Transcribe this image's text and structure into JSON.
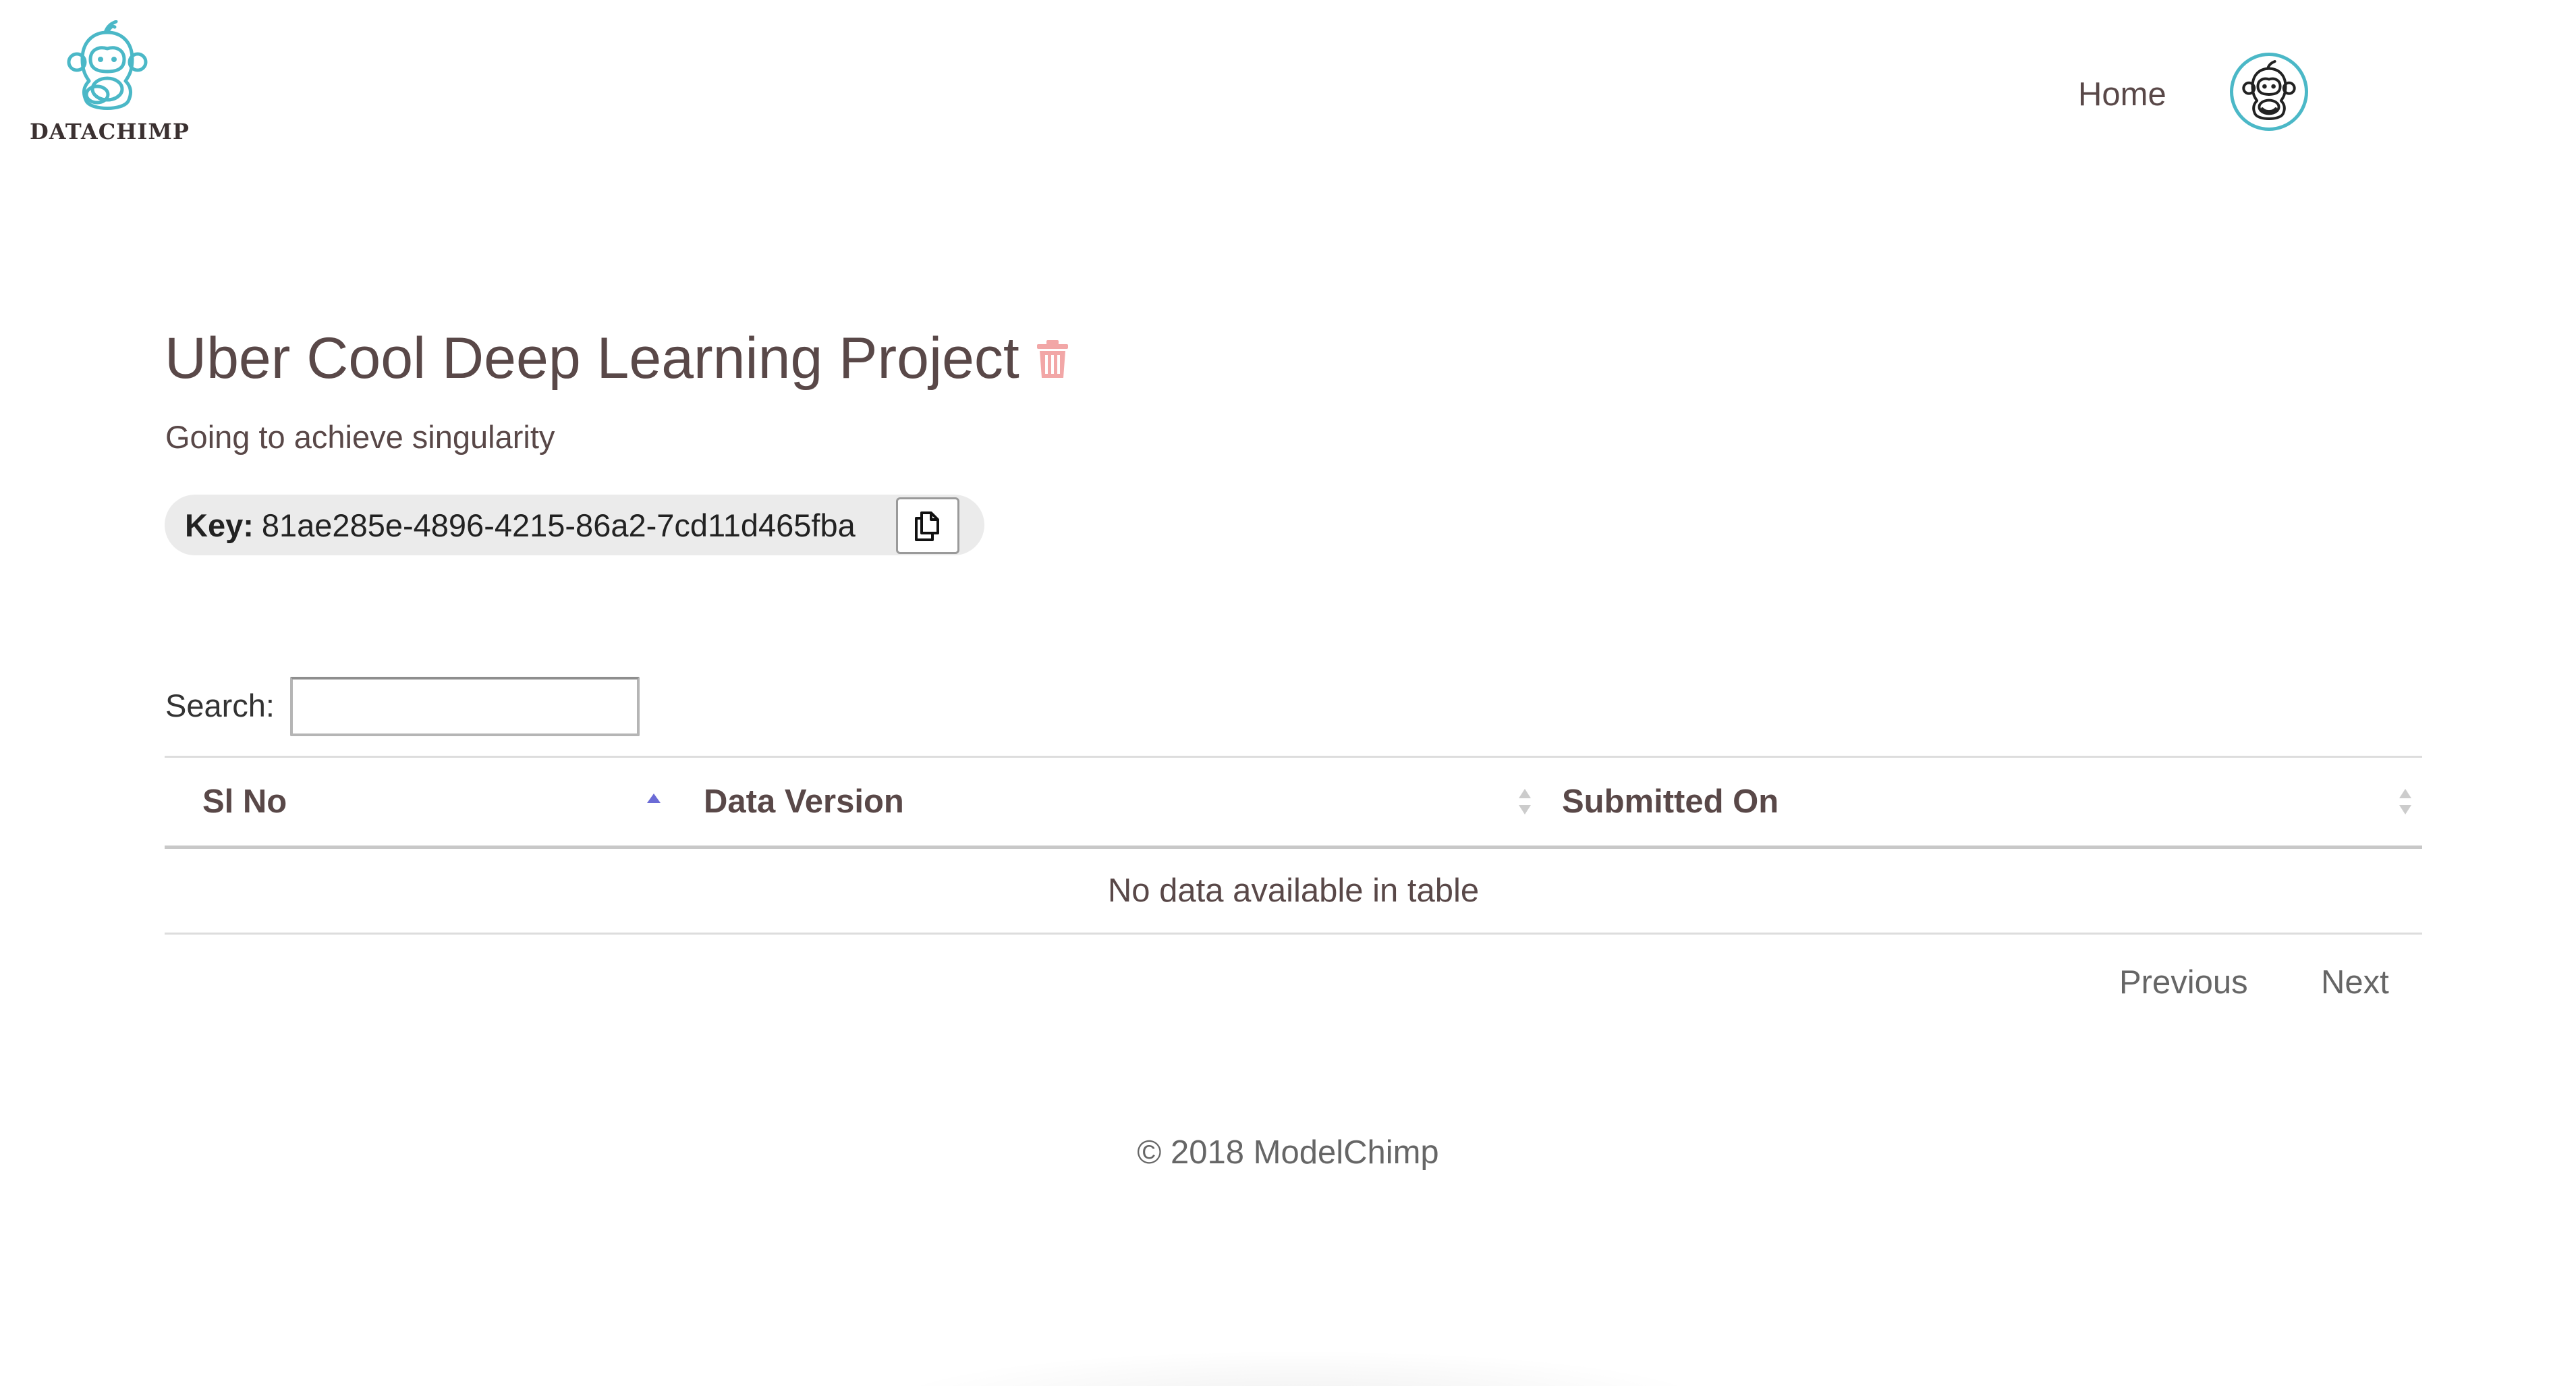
{
  "header": {
    "logo_text": "DATACHIMP",
    "nav_home": "Home"
  },
  "project": {
    "title": "Uber Cool Deep Learning Project",
    "description": "Going to achieve singularity",
    "key_label": "Key:",
    "key_value": "81ae285e-4896-4215-86a2-7cd11d465fba"
  },
  "search": {
    "label": "Search:",
    "value": ""
  },
  "table": {
    "columns": [
      "Sl No",
      "Data Version",
      "Submitted On"
    ],
    "sorted_column": "Sl No",
    "sort_direction": "ascending",
    "empty_message": "No data available in table"
  },
  "pagination": {
    "previous_label": "Previous",
    "next_label": "Next"
  },
  "footer": {
    "copyright": "© 2018 ModelChimp"
  },
  "colors": {
    "brand_teal": "#4bb8c7",
    "text": "#594848",
    "delete_icon": "#f2a7a7",
    "sort_active": "#6b6bd6",
    "sort_inactive": "#cccccc"
  }
}
